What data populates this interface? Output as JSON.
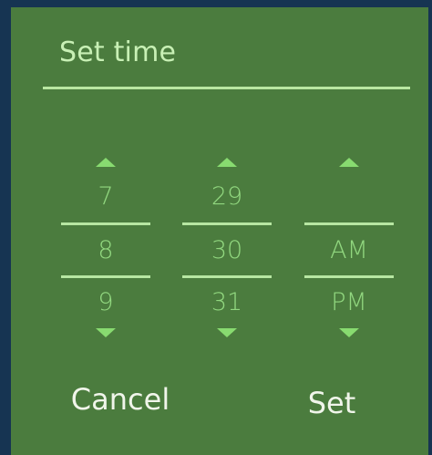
{
  "dialog": {
    "title": "Set time",
    "hour_column": {
      "above": "7",
      "selected": "8",
      "below": "9"
    },
    "minute_column": {
      "above": "29",
      "selected": "30",
      "below": "31"
    },
    "ampm_column": {
      "above": "",
      "selected": "AM",
      "below": "PM"
    },
    "buttons": {
      "cancel": "Cancel",
      "set": "Set"
    }
  },
  "colors": {
    "backdrop": "#163452",
    "dialog_background": "#4b7c3e",
    "title_text": "#c8f0b5",
    "picker_value": "#91d77f",
    "arrow": "#88db70",
    "divider": "#b7e6a2",
    "button_text": "#f0f5ea"
  },
  "icons": {
    "increment": "triangle-up",
    "decrement": "triangle-down"
  }
}
